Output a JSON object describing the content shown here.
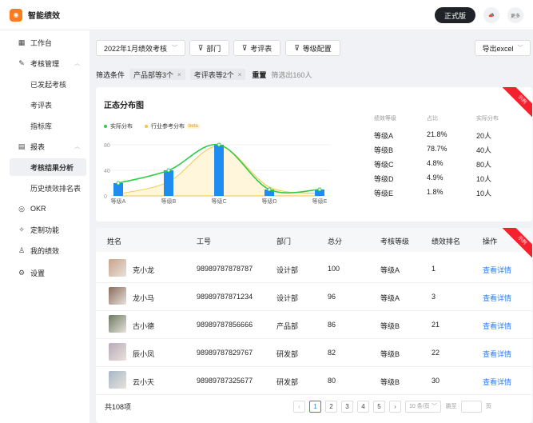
{
  "app": {
    "title": "智能绩效",
    "pro_label": "正式版",
    "more_label": "更多"
  },
  "sidebar": {
    "workbench": "工作台",
    "assess_mgmt": "考核管理",
    "assess_sub": [
      "已发起考核",
      "考评表",
      "指标库"
    ],
    "reports": "报表",
    "reports_sub": [
      "考核结果分析",
      "历史绩效排名表"
    ],
    "okr": "OKR",
    "custom": "定制功能",
    "my_perf": "我的绩效",
    "settings": "设置"
  },
  "toolbar": {
    "period": "2022年1月绩效考核",
    "dept": "部门",
    "sheet": "考评表",
    "grade_cfg": "等级配置",
    "export": "导出excel"
  },
  "filters": {
    "label": "筛选条件",
    "tags": [
      "产品部等3个",
      "考评表等2个"
    ],
    "reset": "重置",
    "result": "筛选出160人"
  },
  "chart_card": {
    "title": "正态分布图",
    "ribbon": "示例",
    "legend_actual": "实际分布",
    "legend_industry": "行业参考分布",
    "beta": "beta",
    "grade_headers": [
      "绩效等级",
      "占比",
      "实际分布"
    ],
    "grades": [
      [
        "等级A",
        "21.8%",
        "20人"
      ],
      [
        "等级B",
        "78.7%",
        "40人"
      ],
      [
        "等级C",
        "4.8%",
        "80人"
      ],
      [
        "等级D",
        "4.9%",
        "10人"
      ],
      [
        "等级E",
        "1.8%",
        "10人"
      ]
    ]
  },
  "chart_data": {
    "type": "bar",
    "categories": [
      "等级A",
      "等级B",
      "等级C",
      "等级D",
      "等级E"
    ],
    "values": [
      20,
      40,
      80,
      10,
      10
    ],
    "industry": [
      3,
      22,
      78,
      14,
      4
    ],
    "yticks": [
      0,
      40,
      80
    ],
    "ylim": [
      0,
      90
    ],
    "colors": {
      "bar": "#1e8cf0",
      "actual": "#2fcc4a",
      "industry": "#f2c84b"
    }
  },
  "table": {
    "ribbon": "示例",
    "headers": [
      "姓名",
      "工号",
      "部门",
      "总分",
      "考核等级",
      "绩效排名",
      "操作"
    ],
    "rows": [
      [
        "克小龙",
        "98989787878787",
        "设计部",
        "100",
        "等级A",
        "1",
        "查看详情"
      ],
      [
        "龙小马",
        "98989787871234",
        "设计部",
        "96",
        "等级A",
        "3",
        "查看详情"
      ],
      [
        "古小德",
        "98989787856666",
        "产品部",
        "86",
        "等级B",
        "21",
        "查看详情"
      ],
      [
        "辰小凤",
        "98989787829767",
        "研发部",
        "82",
        "等级B",
        "22",
        "查看详情"
      ],
      [
        "云小天",
        "98989787325677",
        "研发部",
        "80",
        "等级B",
        "30",
        "查看详情"
      ]
    ],
    "total": "共108项",
    "pages": [
      "1",
      "2",
      "3",
      "4",
      "5"
    ],
    "per_page": "10 条/页",
    "goto": "跳至",
    "page_unit": "页"
  }
}
